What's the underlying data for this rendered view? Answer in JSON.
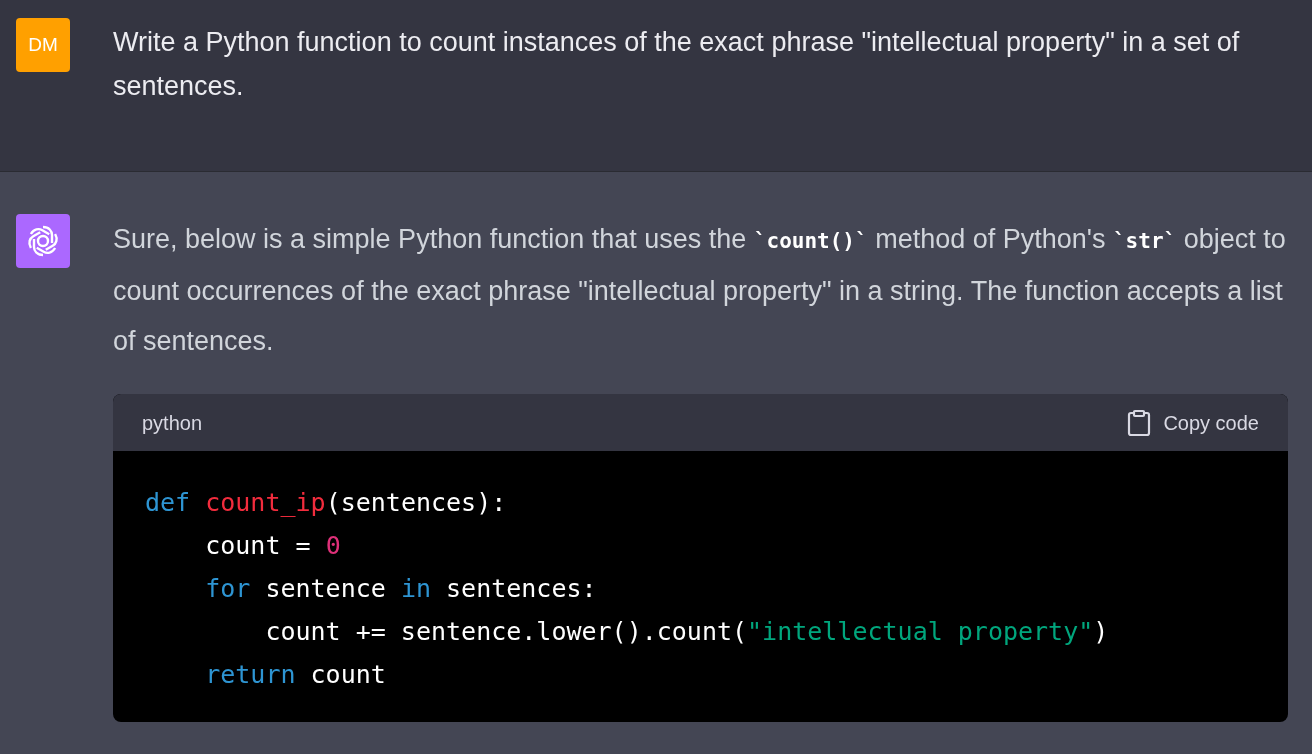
{
  "messages": [
    {
      "kind": "user",
      "avatar": "DM",
      "segments": [
        {
          "kind": "text",
          "text": "Write a Python function to count instances of the exact phrase \"intellectual property\" in a set of sentences."
        }
      ]
    },
    {
      "kind": "assistant",
      "segments": [
        {
          "kind": "text",
          "text": "Sure, below is a simple Python function that uses the "
        },
        {
          "kind": "code",
          "text": "`count()`"
        },
        {
          "kind": "text",
          "text": " method of Python's "
        },
        {
          "kind": "code",
          "text": "`str`"
        },
        {
          "kind": "text",
          "text": " object to count occurrences of the exact phrase \"intellectual property\" in a string. The function accepts a list of sentences."
        }
      ],
      "code_block": {
        "language": "python",
        "copy_label": "Copy code",
        "lines": [
          [
            {
              "kind": "keyword",
              "text": "def"
            },
            {
              "kind": "function",
              "text": " count_ip"
            },
            {
              "kind": "plain",
              "text": "(sentences):"
            }
          ],
          [
            {
              "kind": "plain",
              "text": "    count = "
            },
            {
              "kind": "number",
              "text": "0"
            }
          ],
          [
            {
              "kind": "keyword",
              "text": "    for"
            },
            {
              "kind": "plain",
              "text": " sentence "
            },
            {
              "kind": "keyword",
              "text": "in"
            },
            {
              "kind": "plain",
              "text": " sentences:"
            }
          ],
          [
            {
              "kind": "plain",
              "text": "        count += sentence.lower().count("
            },
            {
              "kind": "string",
              "text": "\"intellectual property\""
            },
            {
              "kind": "plain",
              "text": ")"
            }
          ],
          [
            {
              "kind": "keyword",
              "text": "    return"
            },
            {
              "kind": "plain",
              "text": " count"
            }
          ]
        ]
      }
    }
  ]
}
